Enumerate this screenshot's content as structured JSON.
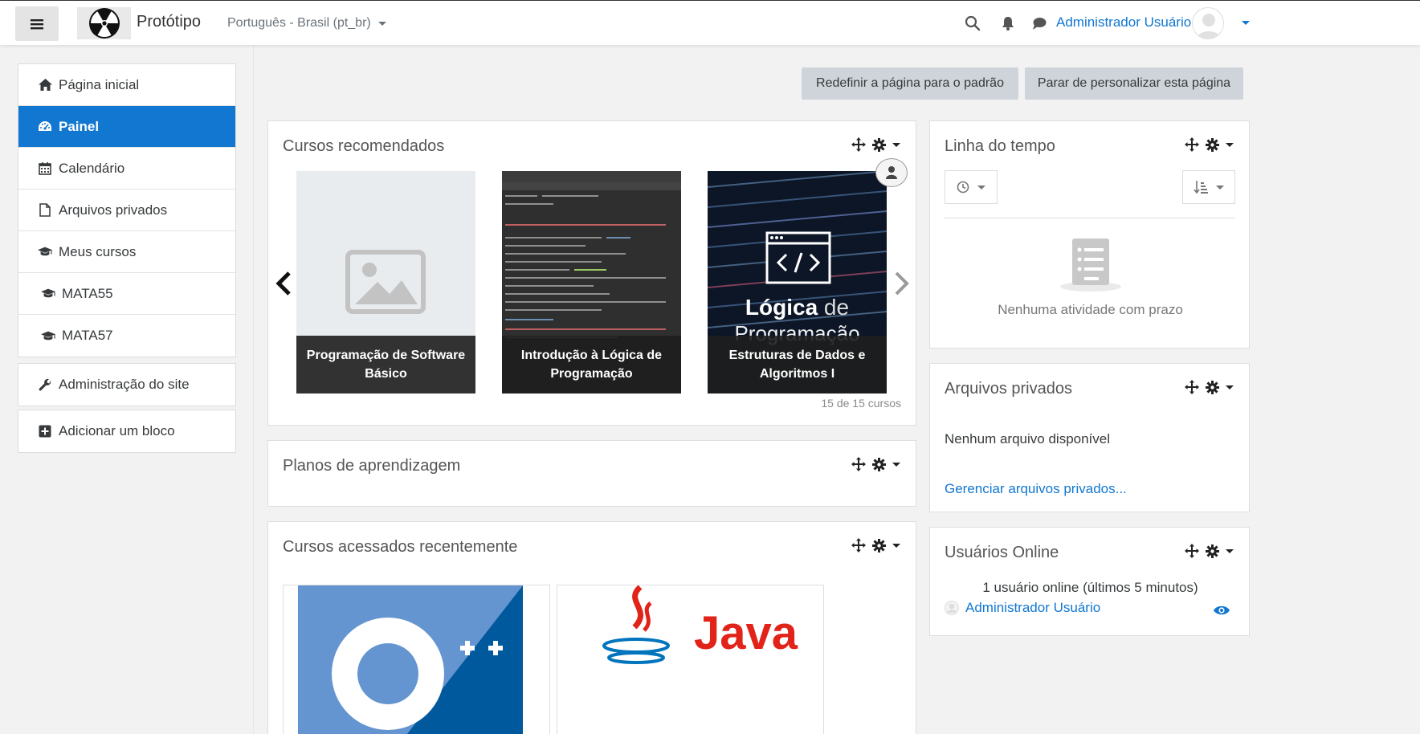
{
  "navbar": {
    "site_name": "Protótipo",
    "language": "Português - Brasil (pt_br)",
    "user_name": "Administrador Usuário"
  },
  "drawer": {
    "group1": [
      {
        "label": "Página inicial",
        "icon": "home-icon"
      },
      {
        "label": "Painel",
        "icon": "dashboard-icon",
        "active": true
      },
      {
        "label": "Calendário",
        "icon": "calendar-icon"
      },
      {
        "label": "Arquivos privados",
        "icon": "file-icon"
      },
      {
        "label": "Meus cursos",
        "icon": "graduation-cap-icon"
      },
      {
        "label": "MATA55",
        "icon": "graduation-cap-icon"
      },
      {
        "label": "MATA57",
        "icon": "graduation-cap-icon"
      }
    ],
    "group2": [
      {
        "label": "Administração do site",
        "icon": "wrench-icon"
      }
    ],
    "group3": [
      {
        "label": "Adicionar um bloco",
        "icon": "plus-square-icon"
      }
    ]
  },
  "page_actions": {
    "reset_label": "Redefinir a página para o padrão",
    "stop_label": "Parar de personalizar esta página"
  },
  "recommended": {
    "title": "Cursos recomendados",
    "courses": [
      {
        "name": "Programação de Software Básico"
      },
      {
        "name": "Introdução à Lógica de Programação"
      },
      {
        "name": "Estruturas de Dados e Algoritmos I"
      }
    ],
    "count_label": "15 de 15 cursos",
    "logic_image_text1": "Lógica",
    "logic_image_text2": "de",
    "logic_image_text3": "Programação"
  },
  "learning_plans": {
    "title": "Planos de aprendizagem"
  },
  "recent_courses": {
    "title": "Cursos acessados recentemente",
    "java_text": "Java"
  },
  "timeline": {
    "title": "Linha do tempo",
    "empty_label": "Nenhuma atividade com prazo"
  },
  "private_files": {
    "title": "Arquivos privados",
    "empty_label": "Nenhum arquivo disponível",
    "manage_label": "Gerenciar arquivos privados..."
  },
  "online_users": {
    "title": "Usuários Online",
    "summary": "1 usuário online (últimos 5 minutos)",
    "users": [
      {
        "name": "Administrador Usuário"
      }
    ]
  },
  "colors": {
    "accent": "#1177d1",
    "navbar_bg": "#ffffff",
    "page_bg": "#f2f2f2"
  }
}
